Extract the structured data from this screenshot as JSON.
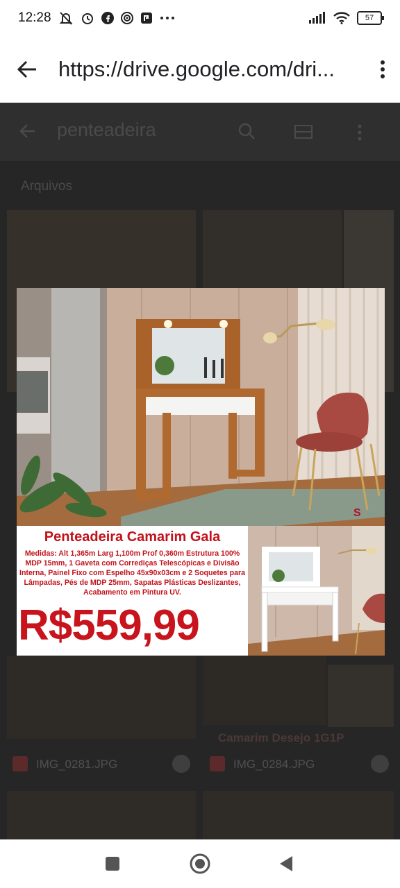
{
  "status_bar": {
    "time": "12:28",
    "battery": "57",
    "icons": [
      "mute-icon",
      "alarm-icon",
      "facebook-icon",
      "radio-icon",
      "app-icon",
      "more-icon"
    ]
  },
  "browser": {
    "url": "https://drive.google.com/dri..."
  },
  "drive_bg": {
    "search_text": "penteadeira",
    "section_label": "Arquivos",
    "files": [
      {
        "name": "IMG_0281.JPG"
      },
      {
        "name": "IMG_0284.JPG"
      }
    ],
    "right_tile_title": "Camarim Desejo 1G1P"
  },
  "viewer": {
    "title": "Penteadeira Camarim Gala",
    "description": "Medidas: Alt 1,365m Larg 1,100m Prof 0,360m Estrutura 100% MDP 15mm, 1 Gaveta com Corrediças Telescópicas e Divisão Interna, Painel Fixo com Espelho 45x90x03cm e 2 Soquetes para Lâmpadas, Pés de MDP 25mm, Sapatas Plásticas Deslizantes, Acabamento em Pintura UV.",
    "price": "R$559,99",
    "corner_mark": "S"
  },
  "colors": {
    "price_red": "#c8141c",
    "wood": "#b0692e",
    "wall": "#cdb4a4"
  }
}
